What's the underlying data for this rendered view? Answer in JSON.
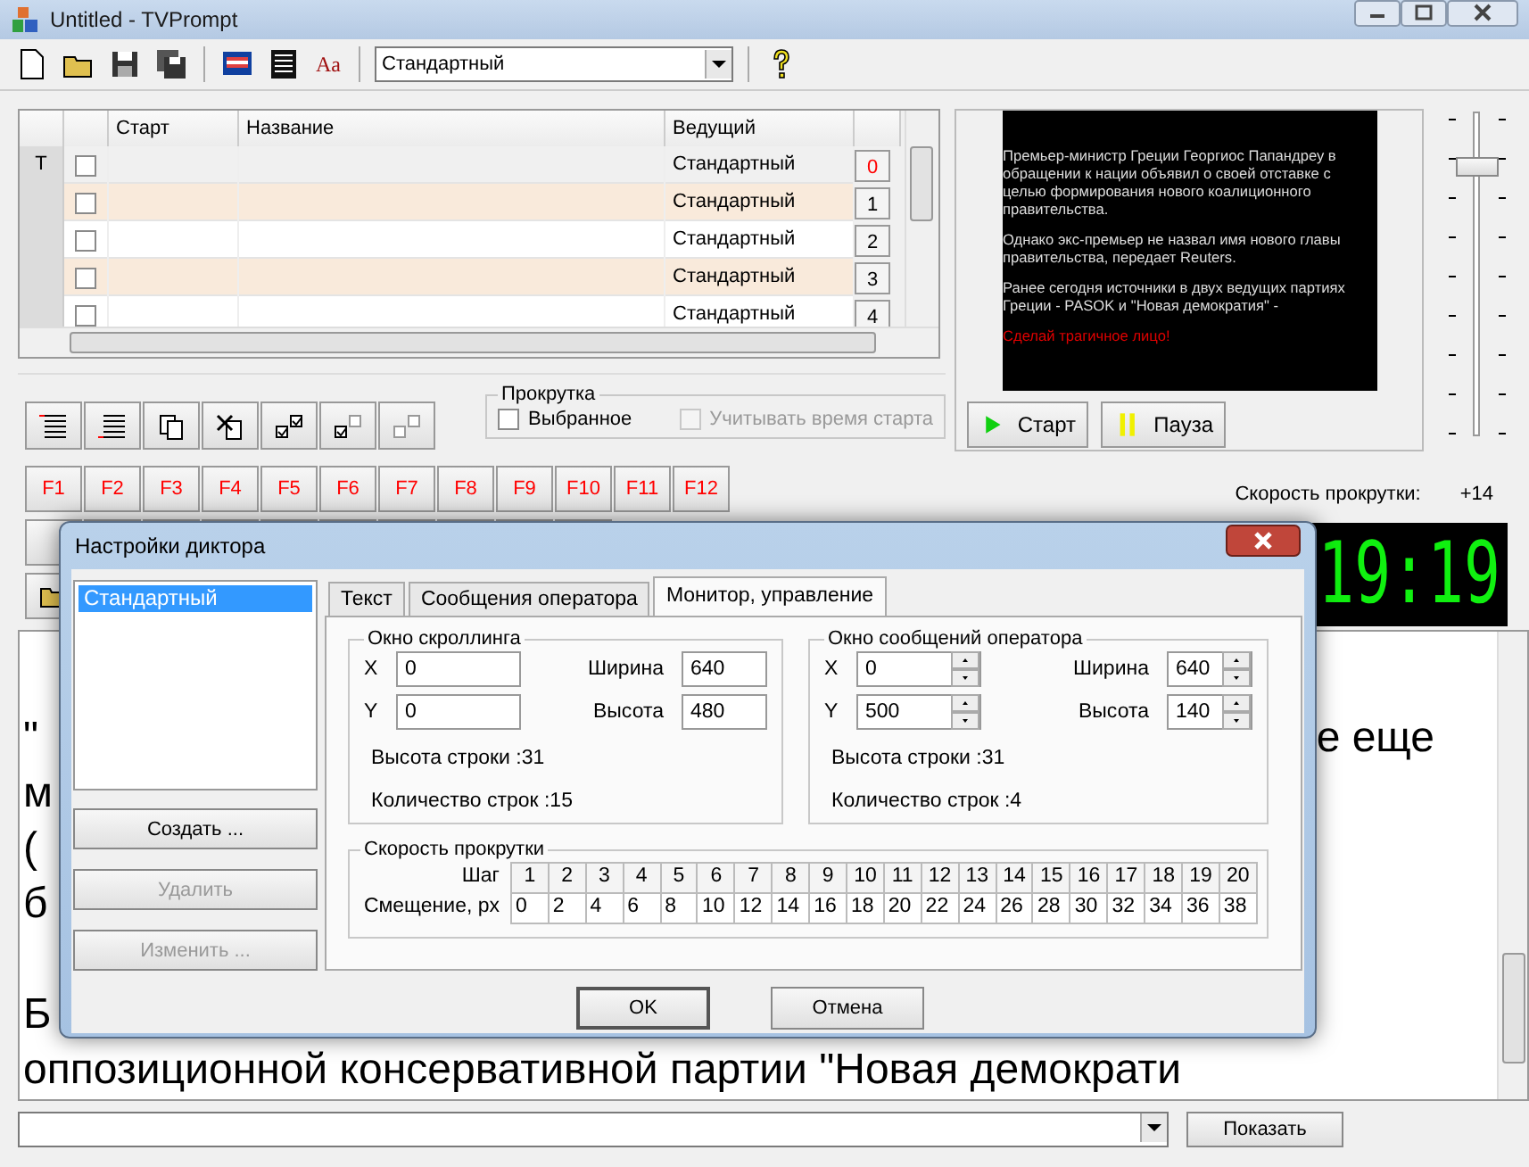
{
  "window": {
    "title": "Untitled - TVPrompt"
  },
  "toolbar": {
    "style_select": "Стандартный",
    "font_button": "Aa"
  },
  "table": {
    "columns": [
      "Старт",
      "Название",
      "Ведущий"
    ],
    "rows": [
      {
        "marker": "T",
        "checked": false,
        "presenter": "Стандартный",
        "number": "0",
        "current": true,
        "highlighted": false
      },
      {
        "checked": false,
        "presenter": "Стандартный",
        "number": "1",
        "current": false,
        "highlighted": true
      },
      {
        "checked": false,
        "presenter": "Стандартный",
        "number": "2",
        "current": false,
        "highlighted": false
      },
      {
        "checked": false,
        "presenter": "Стандартный",
        "number": "3",
        "current": false,
        "highlighted": true
      },
      {
        "checked": false,
        "presenter": "Стандартный",
        "number": "4",
        "current": false,
        "highlighted": false
      }
    ]
  },
  "scroll_group": {
    "title": "Прокрутка",
    "options": [
      {
        "label": "Выбранное",
        "checked": false,
        "disabled": false
      },
      {
        "label": "Учитывать время старта",
        "checked": false,
        "disabled": true
      }
    ]
  },
  "function_keys": [
    "F1",
    "F2",
    "F3",
    "F4",
    "F5",
    "F6",
    "F7",
    "F8",
    "F9",
    "F10",
    "F11",
    "F12"
  ],
  "preview": {
    "paragraphs": [
      {
        "kind": "text",
        "text": "Премьер-министр Греции Георгиос Папандреу в обращении к нации объявил о своей отставке с целью формирования нового коалиционного правительства."
      },
      {
        "kind": "text",
        "text": "Однако экс-премьер не назвал имя нового главы правительства, передает Reuters."
      },
      {
        "kind": "text",
        "text": "Ранее сегодня источники в двух ведущих партиях Греции - PASOK и \"Новая демократия\" -"
      },
      {
        "kind": "alert",
        "text": "Сделай трагичное лицо!"
      }
    ],
    "buttons": [
      {
        "kind": "play",
        "label": "Старт"
      },
      {
        "kind": "pause",
        "label": "Пауза"
      }
    ]
  },
  "speed": {
    "label": "Скорость прокрутки:",
    "value": "+14",
    "level": 0.84
  },
  "clock": {
    "time": "19:19"
  },
  "editor": {
    "lines": [
      {
        "kind": "text",
        "text": "\"",
        "tail": "е еще"
      },
      {
        "kind": "text",
        "text": "м"
      },
      {
        "kind": "text",
        "text": "("
      },
      {
        "kind": "text",
        "text": "б"
      },
      {
        "kind": "blank"
      },
      {
        "kind": "text",
        "text": "Б"
      },
      {
        "kind": "text",
        "text": "оппозиционной консервативной партии \"Новая демократи"
      }
    ]
  },
  "bottom": {
    "button": "Показать"
  },
  "dialog": {
    "title": "Настройки диктора",
    "profiles": [
      {
        "label": "Стандартный",
        "selected": true
      }
    ],
    "buttons": [
      {
        "label": "Создать ...",
        "disabled": false
      },
      {
        "label": "Удалить",
        "disabled": true
      },
      {
        "label": "Изменить ...",
        "disabled": true
      }
    ],
    "tabs": [
      {
        "label": "Текст",
        "selected": false
      },
      {
        "label": "Сообщения оператора",
        "selected": false
      },
      {
        "label": "Монитор, управление",
        "selected": true
      }
    ],
    "groups": [
      {
        "title": "Окно скроллинга",
        "kind": "plain",
        "fields": [
          {
            "label": "X",
            "value": "0"
          },
          {
            "label": "Ширина",
            "value": "640"
          },
          {
            "label": "Y",
            "value": "0"
          },
          {
            "label": "Высота",
            "value": "480"
          }
        ],
        "notes": [
          "Высота строки :31",
          "Количество строк :15"
        ]
      },
      {
        "title": "Окно сообщений оператора",
        "kind": "spin",
        "fields": [
          {
            "label": "X",
            "value": "0"
          },
          {
            "label": "Ширина",
            "value": "640"
          },
          {
            "label": "Y",
            "value": "500"
          },
          {
            "label": "Высота",
            "value": "140"
          }
        ],
        "notes": [
          "Высота строки :31",
          "Количество строк :4"
        ]
      }
    ],
    "speed_table": {
      "title": "Скорость прокрутки",
      "row_labels": [
        "Шаг",
        "Смещение, px"
      ],
      "steps": [
        "1",
        "2",
        "3",
        "4",
        "5",
        "6",
        "7",
        "8",
        "9",
        "10",
        "11",
        "12",
        "13",
        "14",
        "15",
        "16",
        "17",
        "18",
        "19",
        "20"
      ],
      "offsets": [
        "0",
        "2",
        "4",
        "6",
        "8",
        "10",
        "12",
        "14",
        "16",
        "18",
        "20",
        "22",
        "24",
        "26",
        "28",
        "30",
        "32",
        "34",
        "36",
        "38"
      ]
    },
    "actions": [
      "OK",
      "Отмена"
    ]
  }
}
